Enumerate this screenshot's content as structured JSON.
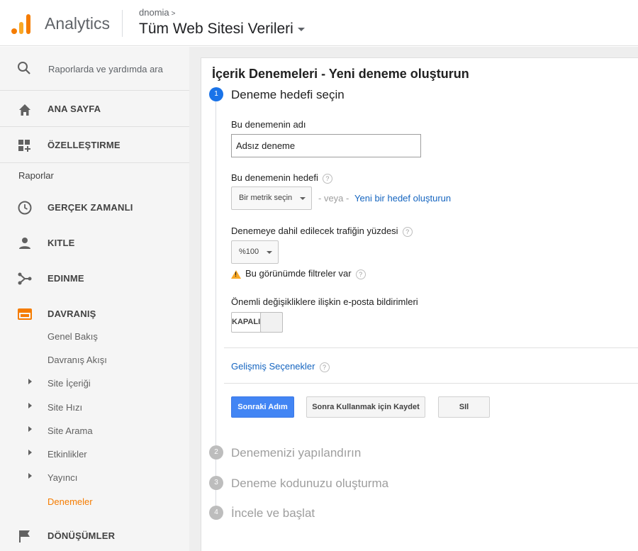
{
  "header": {
    "app_name": "Analytics",
    "account": "dnomia",
    "account_chevron": ">",
    "property": "Tüm Web Sitesi Verileri"
  },
  "sidebar": {
    "search_placeholder": "Raporlarda ve yardımda ara",
    "home": "ANA SAYFA",
    "customization": "ÖZELLEŞTIRME",
    "reports_label": "Raporlar",
    "items": [
      {
        "label": "GERÇEK ZAMANLI",
        "icon": "clock-icon"
      },
      {
        "label": "KITLE",
        "icon": "person-icon"
      },
      {
        "label": "EDINME",
        "icon": "acquisition-icon"
      },
      {
        "label": "DAVRANIŞ",
        "icon": "behavior-icon"
      }
    ],
    "behavior_sub": [
      {
        "label": "Genel Bakış",
        "expandable": false
      },
      {
        "label": "Davranış Akışı",
        "expandable": false
      },
      {
        "label": "Site İçeriği",
        "expandable": true
      },
      {
        "label": "Site Hızı",
        "expandable": true
      },
      {
        "label": "Site Arama",
        "expandable": true
      },
      {
        "label": "Etkinlikler",
        "expandable": true
      },
      {
        "label": "Yayıncı",
        "expandable": true
      },
      {
        "label": "Denemeler",
        "expandable": false
      }
    ],
    "conversions": "DÖNÜŞÜMLER"
  },
  "main": {
    "title": "İçerik Denemeleri - Yeni deneme oluşturun",
    "steps": [
      {
        "number": "1",
        "title": "Deneme hedefi seçin"
      },
      {
        "number": "2",
        "title": "Denemenizi yapılandırın"
      },
      {
        "number": "3",
        "title": "Deneme kodunuzu oluşturma"
      },
      {
        "number": "4",
        "title": "İncele ve başlat"
      }
    ],
    "name_label": "Bu denemenin adı",
    "name_value": "Adsız deneme",
    "goal_label": "Bu denemenin hedefi",
    "goal_select": "Bir metrik seçin",
    "or_text": "- veya -",
    "create_goal_link": "Yeni bir hedef oluşturun",
    "traffic_label": "Denemeye dahil edilecek trafiğin yüzdesi",
    "traffic_select": "%100",
    "filter_warning": "Bu görünümde filtreler var",
    "email_label": "Önemli değişikliklere ilişkin e-posta bildirimleri",
    "toggle_label": "KAPALI",
    "advanced_link": "Gelişmiş Seçenekler",
    "help_glyph": "?",
    "buttons": {
      "next": "Sonraki Adım",
      "save_later": "Sonra Kullanmak için Kaydet",
      "delete": "SIl"
    }
  },
  "colors": {
    "accent_orange": "#f57c00",
    "primary_blue": "#4285f4",
    "link_blue": "#1565c0",
    "step_active": "#1a73e8"
  }
}
